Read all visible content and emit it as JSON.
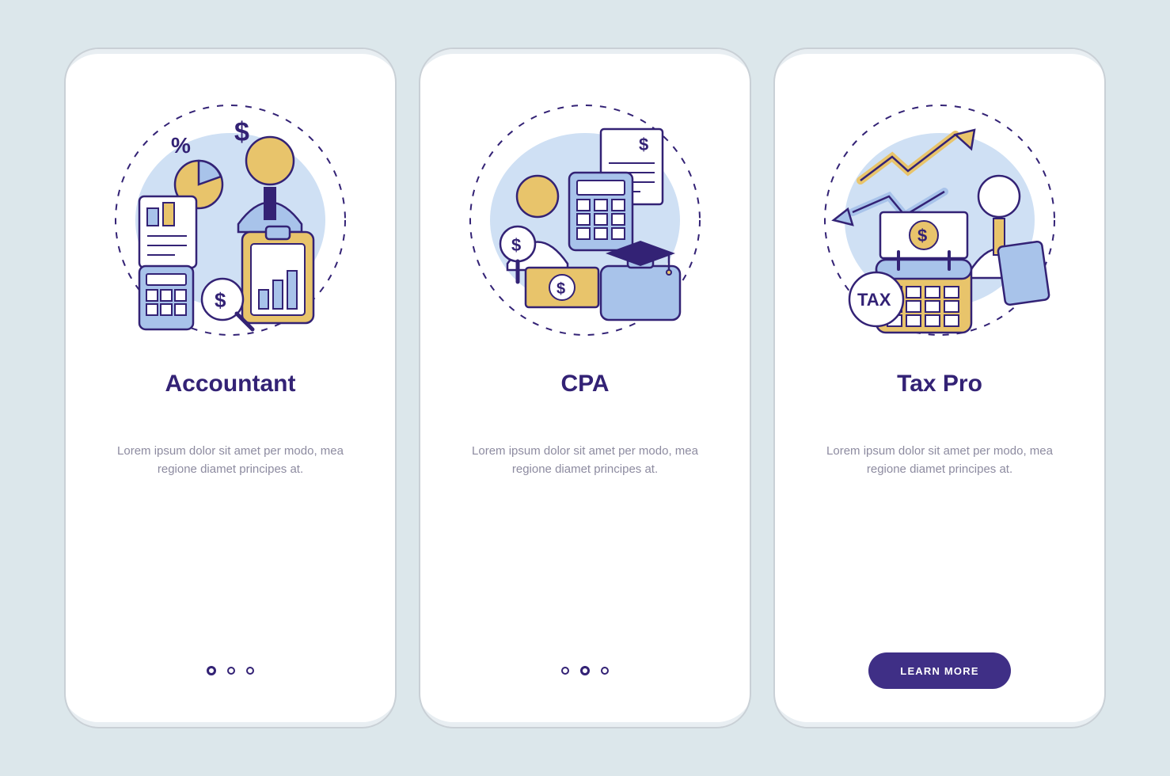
{
  "screens": [
    {
      "title": "Accountant",
      "desc": "Lorem ipsum dolor sit amet per modo, mea regione diamet principes at.",
      "activeDot": 0
    },
    {
      "title": "CPA",
      "desc": "Lorem ipsum dolor sit amet per modo, mea regione diamet principes at.",
      "activeDot": 1
    },
    {
      "title": "Tax Pro",
      "desc": "Lorem ipsum dolor sit amet per modo, mea regione diamet principes at.",
      "cta": "LEARN MORE"
    }
  ],
  "colors": {
    "accent": "#332275",
    "button": "#3f2f86",
    "yellow": "#e8c46b",
    "blue": "#a8c3ea",
    "lightblue": "#cfe0f4"
  },
  "illus_labels": {
    "tax": "TAX"
  }
}
